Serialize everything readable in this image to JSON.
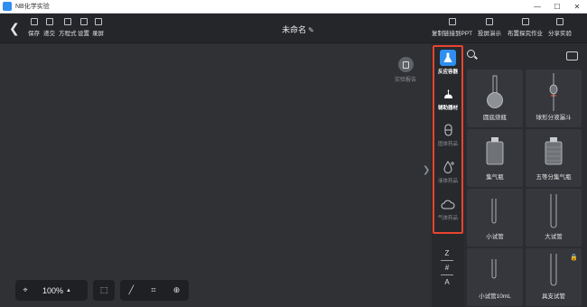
{
  "window": {
    "title": "NB化学实验"
  },
  "toolbar": {
    "left": [
      {
        "label": "保存",
        "icon": "save-icon"
      },
      {
        "label": "递交",
        "icon": "submit-icon"
      },
      {
        "label": "方程式",
        "icon": "equation-icon"
      },
      {
        "label": "设置",
        "icon": "settings-icon"
      },
      {
        "label": "录屏",
        "icon": "record-screen-icon"
      }
    ],
    "doc_title": "未命名",
    "right": [
      {
        "label": "复制链接到PPT",
        "icon": "copy-link-icon"
      },
      {
        "label": "投屏演示",
        "icon": "projector-icon"
      },
      {
        "label": "布置探究作业",
        "icon": "send-icon"
      },
      {
        "label": "分享实验",
        "icon": "share-icon"
      }
    ]
  },
  "canvas": {
    "report_label": "实验报告"
  },
  "bottom": {
    "zoom": "100%"
  },
  "categories": [
    {
      "label": "反应容器",
      "icon": "flask-icon",
      "active": true
    },
    {
      "label": "辅助器材",
      "icon": "alcohol-lamp-icon",
      "active": false
    },
    {
      "label": "固体药品",
      "icon": "capsule-icon",
      "active": false
    },
    {
      "label": "液体药品",
      "icon": "droplet-icon",
      "active": false
    },
    {
      "label": "气体药品",
      "icon": "cloud-icon",
      "active": false
    }
  ],
  "sort": {
    "top": "Z",
    "mid": "#",
    "bottom": "A"
  },
  "items": [
    {
      "label": "圆底烧瓶",
      "icon": "round-flask-icon"
    },
    {
      "label": "球形分液漏斗",
      "icon": "separatory-funnel-icon"
    },
    {
      "label": "集气瓶",
      "icon": "gas-jar-icon"
    },
    {
      "label": "五等分集气瓶",
      "icon": "graduated-gas-jar-icon"
    },
    {
      "label": "小试管",
      "icon": "small-test-tube-icon"
    },
    {
      "label": "大试管",
      "icon": "large-test-tube-icon"
    },
    {
      "label": "小试管10mL",
      "icon": "small-test-tube-10ml-icon"
    },
    {
      "label": "具支试管",
      "icon": "side-arm-test-tube-icon",
      "locked": true
    }
  ],
  "colors": {
    "accent": "#2f8ef0",
    "highlight": "#e8452f",
    "background": "#2d2f33",
    "lock": "#f1c232"
  }
}
